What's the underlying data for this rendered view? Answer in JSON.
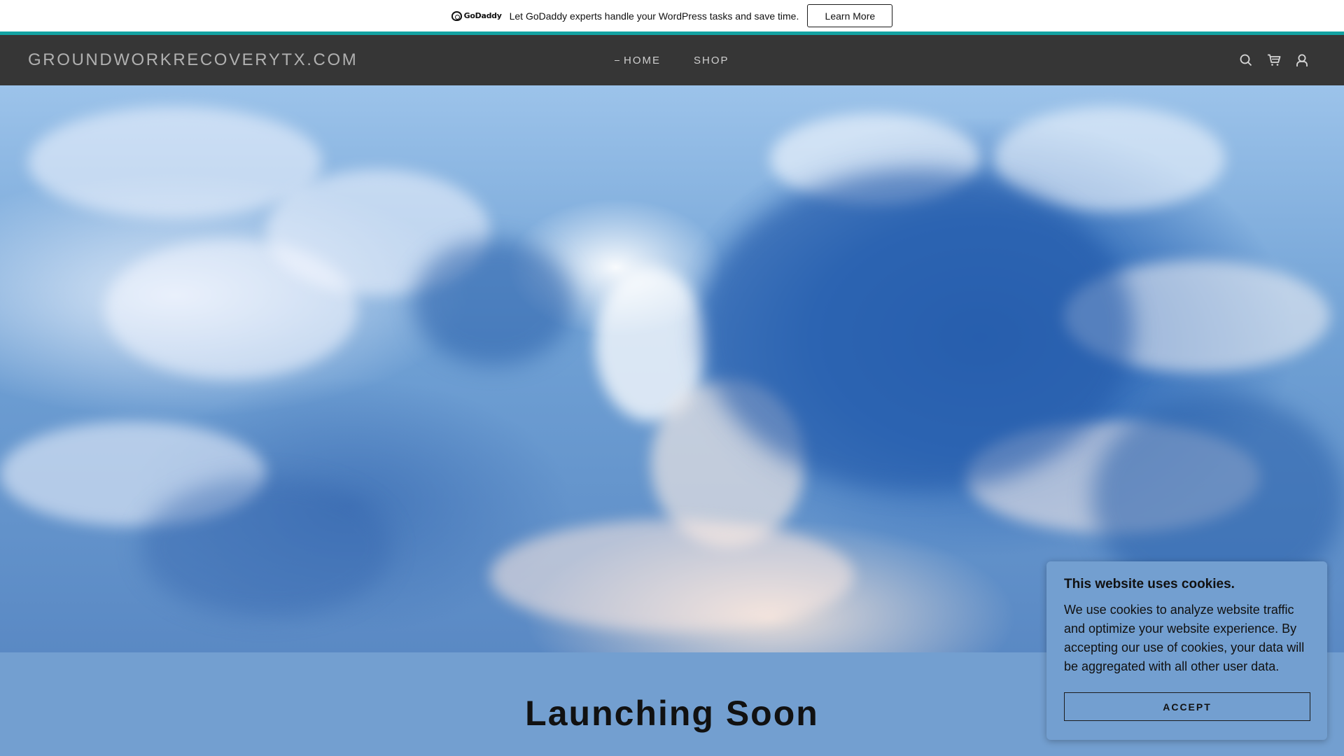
{
  "promo": {
    "brand": "GoDaddy",
    "text": "Let GoDaddy experts handle your WordPress tasks and save time.",
    "button_label": "Learn More"
  },
  "header": {
    "site_title": "GROUNDWORKRECOVERYTX.COM",
    "nav": [
      {
        "label": "HOME",
        "active": true
      },
      {
        "label": "SHOP",
        "active": false
      }
    ],
    "icons": [
      "search-icon",
      "cart-icon",
      "account-icon"
    ]
  },
  "hero": {
    "image": "sky-with-clouds"
  },
  "launch": {
    "title": "Launching Soon"
  },
  "cookie": {
    "title": "This website uses cookies.",
    "text": "We use cookies to analyze website traffic and optimize your website experience. By accepting our use of cookies, your data will be aggregated with all other user data.",
    "button_label": "ACCEPT"
  },
  "colors": {
    "accent_line": "#13a2a2",
    "header_bg": "#363636",
    "section_bg": "#739fd0"
  }
}
